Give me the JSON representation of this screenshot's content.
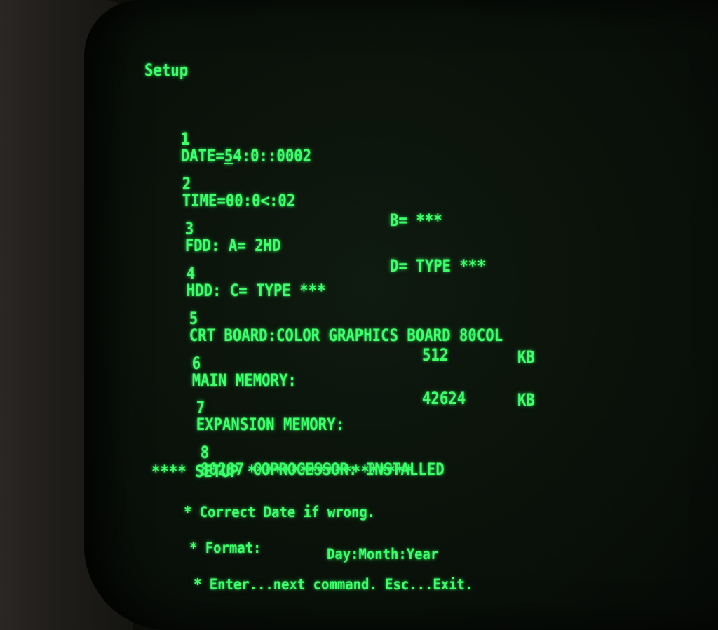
{
  "setup": {
    "title": "Setup",
    "items": [
      {
        "num": "1",
        "label": "DATE=",
        "cursor": "5",
        "value": "4:0::0002"
      },
      {
        "num": "2",
        "label": "TIME=",
        "value": "00:0<:02"
      },
      {
        "num": "3",
        "label": "FDD: A= 2HD",
        "right": "B= ***"
      },
      {
        "num": "4",
        "label": "HDD: C= TYPE ***",
        "right": "D= TYPE ***"
      },
      {
        "num": "5",
        "label": "CRT BOARD:COLOR GRAPHICS BOARD 80COL"
      },
      {
        "num": "6",
        "label": "MAIN MEMORY:",
        "value": "512",
        "unit": "KB"
      },
      {
        "num": "7",
        "label": "EXPANSION MEMORY:",
        "value": "42624",
        "unit": "KB"
      },
      {
        "num": "8",
        "label": "80287 COPROCESSOR: INSTALLED"
      }
    ],
    "banner": "**** SETUP *******************",
    "help": {
      "line1": "* Correct Date if wrong.",
      "format_label": "* Format:",
      "format_value": "Day:Month:Year",
      "line3": "* Enter...next command. Esc...Exit."
    }
  },
  "colors": {
    "phosphor": "#3cff6a",
    "screen_background": "#0b130b"
  }
}
